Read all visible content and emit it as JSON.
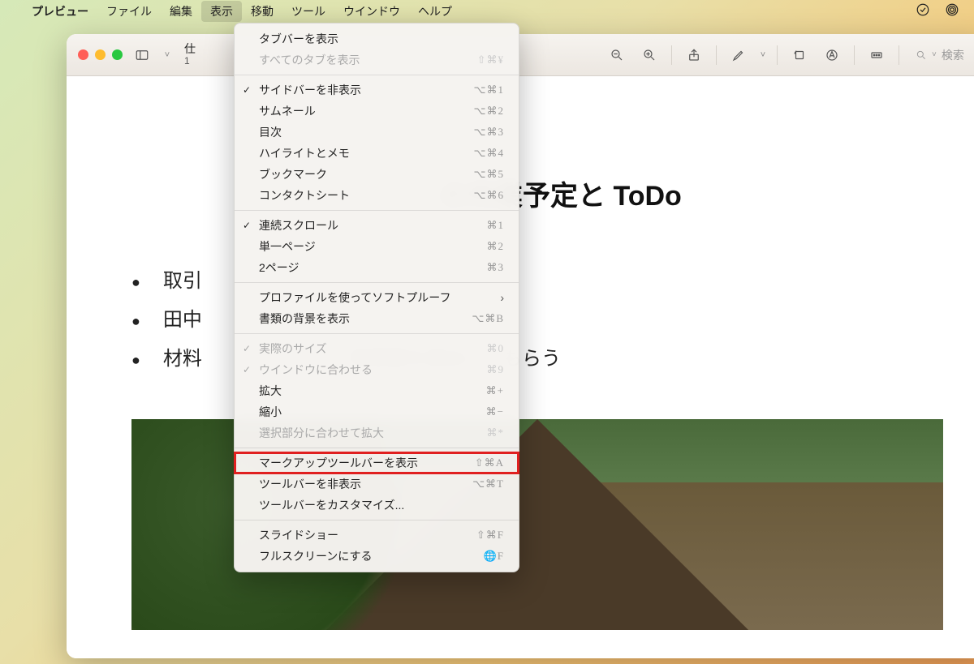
{
  "menubar": {
    "items": [
      "プレビュー",
      "ファイル",
      "編集",
      "表示",
      "移動",
      "ツール",
      "ウインドウ",
      "ヘルプ"
    ],
    "active_index": 3
  },
  "tray": {
    "icon1": "checklist-icon",
    "icon2": "airdrop-icon"
  },
  "window": {
    "title_line1": "仕",
    "title_line2": "1"
  },
  "toolbar": {
    "search_placeholder": "検索"
  },
  "menu": {
    "groups": [
      [
        {
          "label": "タブバーを表示",
          "shortcut": "",
          "checked": false,
          "disabled": false
        },
        {
          "label": "すべてのタブを表示",
          "shortcut": "⇧⌘¥",
          "checked": false,
          "disabled": true
        }
      ],
      [
        {
          "label": "サイドバーを非表示",
          "shortcut": "⌥⌘1",
          "checked": true,
          "disabled": false
        },
        {
          "label": "サムネール",
          "shortcut": "⌥⌘2",
          "checked": false,
          "disabled": false
        },
        {
          "label": "目次",
          "shortcut": "⌥⌘3",
          "checked": false,
          "disabled": false
        },
        {
          "label": "ハイライトとメモ",
          "shortcut": "⌥⌘4",
          "checked": false,
          "disabled": false
        },
        {
          "label": "ブックマーク",
          "shortcut": "⌥⌘5",
          "checked": false,
          "disabled": false
        },
        {
          "label": "コンタクトシート",
          "shortcut": "⌥⌘6",
          "checked": false,
          "disabled": false
        }
      ],
      [
        {
          "label": "連続スクロール",
          "shortcut": "⌘1",
          "checked": true,
          "disabled": false
        },
        {
          "label": "単一ページ",
          "shortcut": "⌘2",
          "checked": false,
          "disabled": false
        },
        {
          "label": "2ページ",
          "shortcut": "⌘3",
          "checked": false,
          "disabled": false
        }
      ],
      [
        {
          "label": "プロファイルを使ってソフトプルーフ",
          "submenu": true,
          "disabled": false
        },
        {
          "label": "書類の背景を表示",
          "shortcut": "⌥⌘B",
          "checked": false,
          "disabled": false
        }
      ],
      [
        {
          "label": "実際のサイズ",
          "shortcut": "⌘0",
          "checked": true,
          "disabled": true
        },
        {
          "label": "ウインドウに合わせる",
          "shortcut": "⌘9",
          "checked": true,
          "disabled": true
        },
        {
          "label": "拡大",
          "shortcut": "⌘+",
          "checked": false,
          "disabled": false
        },
        {
          "label": "縮小",
          "shortcut": "⌘−",
          "checked": false,
          "disabled": false
        },
        {
          "label": "選択部分に合わせて拡大",
          "shortcut": "⌘*",
          "checked": false,
          "disabled": true
        }
      ],
      [
        {
          "label": "マークアップツールバーを表示",
          "shortcut": "⇧⌘A",
          "checked": false,
          "disabled": false,
          "highlight": true
        },
        {
          "label": "ツールバーを非表示",
          "shortcut": "⌥⌘T",
          "checked": false,
          "disabled": false
        },
        {
          "label": "ツールバーをカスタマイズ...",
          "shortcut": "",
          "checked": false,
          "disabled": false
        }
      ],
      [
        {
          "label": "スライドショー",
          "shortcut": "⇧⌘F",
          "checked": false,
          "disabled": false
        },
        {
          "label": "フルスクリーンにする",
          "shortcut": "🌐F",
          "checked": false,
          "disabled": false
        }
      ]
    ]
  },
  "document": {
    "heading": "の作業予定と ToDo",
    "bullets": [
      "取引",
      "田中",
      "材料"
    ],
    "bullet3_tail": "見積書を提出してもらう"
  }
}
